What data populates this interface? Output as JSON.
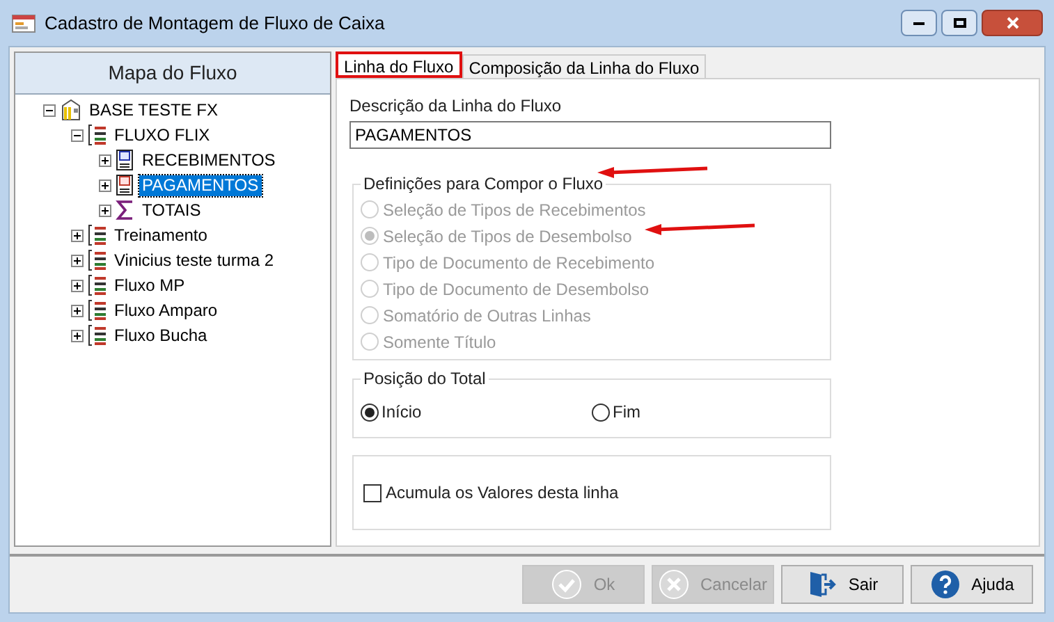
{
  "window": {
    "title": "Cadastro de Montagem de Fluxo de Caixa"
  },
  "sidebar": {
    "title": "Mapa do Fluxo",
    "tree": [
      {
        "label": "BASE TESTE FX",
        "kind": "base",
        "expanded": true,
        "selected": false,
        "children": [
          {
            "label": "FLUXO FLIX",
            "kind": "flow",
            "expanded": true,
            "selected": false,
            "children": [
              {
                "label": "RECEBIMENTOS",
                "kind": "receipt",
                "expanded": false,
                "selected": false
              },
              {
                "label": "PAGAMENTOS",
                "kind": "payment",
                "expanded": false,
                "selected": true
              },
              {
                "label": "TOTAIS",
                "kind": "sum",
                "expanded": false,
                "selected": false
              }
            ]
          },
          {
            "label": "Treinamento",
            "kind": "flow",
            "expanded": false,
            "selected": false
          },
          {
            "label": "Vinicius teste turma 2",
            "kind": "flow",
            "expanded": false,
            "selected": false
          },
          {
            "label": "Fluxo MP",
            "kind": "flow",
            "expanded": false,
            "selected": false
          },
          {
            "label": "Fluxo Amparo",
            "kind": "flow",
            "expanded": false,
            "selected": false
          },
          {
            "label": "Fluxo Bucha",
            "kind": "flow",
            "expanded": false,
            "selected": false
          }
        ]
      }
    ]
  },
  "tabs": [
    {
      "label": "Linha do Fluxo",
      "selected": true
    },
    {
      "label": "Composição da Linha do Fluxo",
      "selected": false
    }
  ],
  "description": {
    "label": "Descrição da Linha do Fluxo",
    "value": "PAGAMENTOS"
  },
  "definitions": {
    "title": "Definições para Compor o Fluxo",
    "disabled": true,
    "options": [
      {
        "label": "Seleção de Tipos de Recebimentos",
        "selected": false
      },
      {
        "label": "Seleção de Tipos de Desembolso",
        "selected": true
      },
      {
        "label": "Tipo de Documento de Recebimento",
        "selected": false
      },
      {
        "label": "Tipo de Documento de Desembolso",
        "selected": false
      },
      {
        "label": "Somatório de Outras Linhas",
        "selected": false
      },
      {
        "label": "Somente Título",
        "selected": false
      }
    ]
  },
  "total_position": {
    "title": "Posição do Total",
    "options": [
      {
        "label": "Início",
        "selected": true
      },
      {
        "label": "Fim",
        "selected": false
      }
    ]
  },
  "accumulate": {
    "label": "Acumula os Valores desta linha",
    "checked": false
  },
  "buttons": [
    {
      "label": "Ok",
      "kind": "ok",
      "disabled": true
    },
    {
      "label": "Cancelar",
      "kind": "cancel",
      "disabled": true
    },
    {
      "label": "Sair",
      "kind": "exit",
      "disabled": false
    },
    {
      "label": "Ajuda",
      "kind": "help",
      "disabled": false
    }
  ]
}
